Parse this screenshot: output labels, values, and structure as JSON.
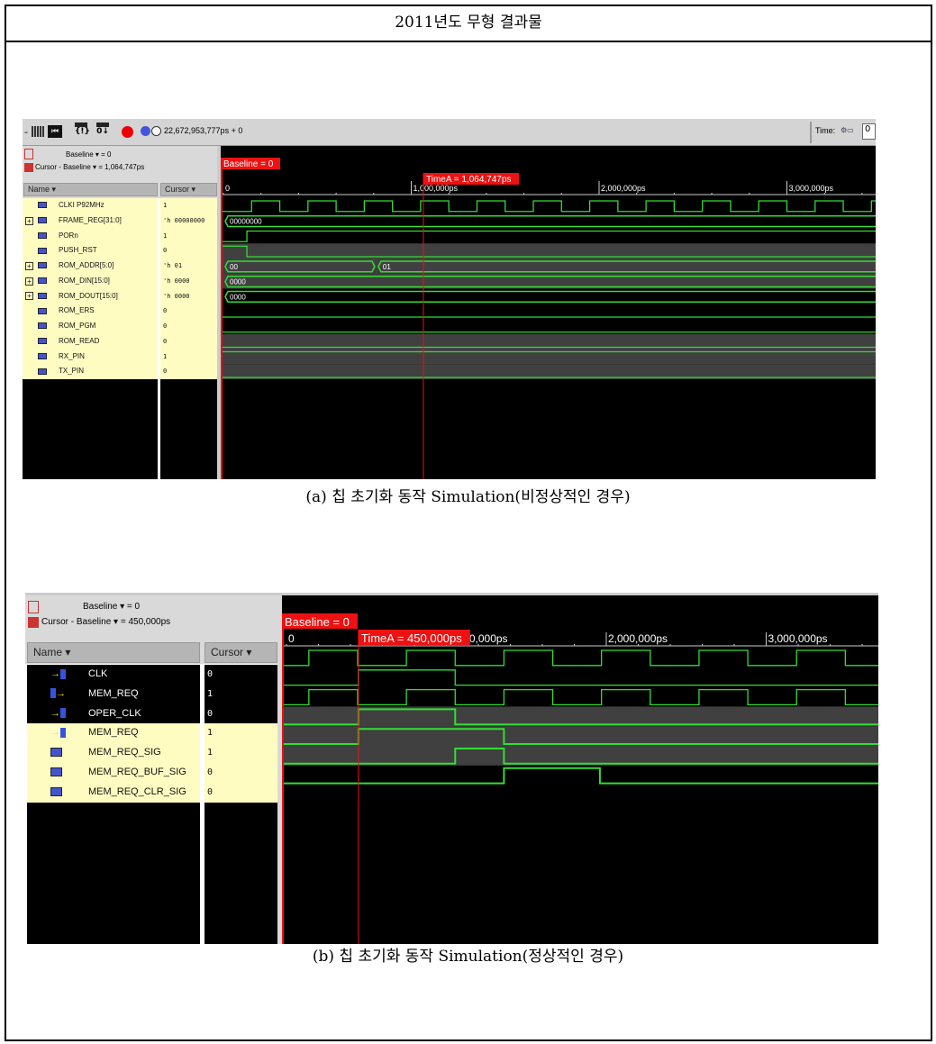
{
  "title": "2011년도 무형 결과물",
  "figure_a": {
    "caption": "(a) 칩 초기화 동작 Simulation(비정상적인 경우)",
    "toolbar": {
      "time_readout": "22,672,953,777ps + 0",
      "time_label": "Time:",
      "time_value": "0"
    },
    "baseline_text": "Baseline ▾ = 0",
    "cursor_baseline_text": "Cursor - Baseline ▾ = 1,064,747ps",
    "name_header": "Name ▾",
    "cursor_header": "Cursor ▾",
    "baseline_marker": "Baseline = 0",
    "timea_marker": "TimeA = 1,064,747ps",
    "cursor_ps": 1064747,
    "ticks": [
      {
        "t": 0,
        "label": "0"
      },
      {
        "t": 1000000,
        "label": "1,000,000ps"
      },
      {
        "t": 2000000,
        "label": "2,000,000ps"
      },
      {
        "t": 3000000,
        "label": "3,000,000ps"
      }
    ],
    "signals": [
      {
        "name": "CLKI P92MHz",
        "value": "1",
        "type": "clock",
        "period": 300000,
        "first_rise": 150000
      },
      {
        "name": "FRAME_REG[31:0]",
        "value": "'h 00000000",
        "type": "bus",
        "expandable": true,
        "segments": [
          {
            "t": 0,
            "v": "00000000"
          }
        ]
      },
      {
        "name": "PORn",
        "value": "1",
        "type": "bit",
        "init": 0,
        "edges": [
          125000
        ]
      },
      {
        "name": "PUSH_RST",
        "value": "0",
        "type": "bit",
        "init": 1,
        "edges": [
          125000
        ],
        "shade": true
      },
      {
        "name": "ROM_ADDR[5:0]",
        "value": "'h 01",
        "type": "bus",
        "expandable": true,
        "shade": true,
        "segments": [
          {
            "t": 0,
            "v": "00"
          },
          {
            "t": 815000,
            "v": "01"
          }
        ]
      },
      {
        "name": "ROM_DIN[15:0]",
        "value": "'h 0000",
        "type": "bus",
        "expandable": true,
        "shade": true,
        "segments": [
          {
            "t": 0,
            "v": "0000"
          }
        ]
      },
      {
        "name": "ROM_DOUT[15:0]",
        "value": "'h 0000",
        "type": "bus",
        "expandable": true,
        "segments": [
          {
            "t": 0,
            "v": "0000"
          }
        ]
      },
      {
        "name": "ROM_ERS",
        "value": "0",
        "type": "bit",
        "init": 0,
        "edges": []
      },
      {
        "name": "ROM_PGM",
        "value": "0",
        "type": "bit",
        "init": 0,
        "edges": []
      },
      {
        "name": "ROM_READ",
        "value": "0",
        "type": "bit",
        "init": 0,
        "edges": [],
        "shade": true
      },
      {
        "name": "RX_PIN",
        "value": "1",
        "type": "bit",
        "init": 1,
        "edges": [],
        "shade": true
      },
      {
        "name": "TX_PIN",
        "value": "0",
        "type": "bit",
        "init": 0,
        "edges": [],
        "shade": true
      }
    ]
  },
  "figure_b": {
    "caption": "(b) 칩 초기화 동작 Simulation(정상적인 경우)",
    "baseline_text": "Baseline ▾ = 0",
    "cursor_baseline_text": "Cursor - Baseline ▾ = 450,000ps",
    "name_header": "Name ▾",
    "cursor_header": "Cursor ▾",
    "baseline_marker": "Baseline = 0",
    "timea_marker": "TimeA = 450,000ps",
    "cursor_ps": 450000,
    "ticks": [
      {
        "t": 0,
        "label": "0"
      },
      {
        "t": 1000000,
        "label": "1,000,000ps"
      },
      {
        "t": 2000000,
        "label": "2,000,000ps"
      },
      {
        "t": 3000000,
        "label": "3,000,000ps"
      }
    ],
    "signals": [
      {
        "name": "CLK",
        "value": "0",
        "type": "clock",
        "period": 610000,
        "first_rise": 140000,
        "port": "in",
        "selected": true
      },
      {
        "name": "MEM_REQ",
        "value": "1",
        "type": "bit",
        "init": 0,
        "edges": [
          450000,
          1055000
        ],
        "port": "out",
        "selected": true
      },
      {
        "name": "OPER_CLK",
        "value": "0",
        "type": "clock",
        "period": 610000,
        "first_rise": 140000,
        "port": "in",
        "selected": true
      },
      {
        "name": "MEM_REQ",
        "value": "1",
        "type": "bit",
        "init": 0,
        "edges": [
          450000,
          1055000
        ],
        "port": "in",
        "shade": true,
        "thick": true
      },
      {
        "name": "MEM_REQ_SIG",
        "value": "1",
        "type": "bit",
        "init": 0,
        "edges": [
          450000,
          1360000
        ],
        "shade": true,
        "thick": true
      },
      {
        "name": "MEM_REQ_BUF_SIG",
        "value": "0",
        "type": "bit",
        "init": 0,
        "edges": [
          1055000,
          1360000
        ],
        "shade": true,
        "thick": true
      },
      {
        "name": "MEM_REQ_CLR_SIG",
        "value": "0",
        "type": "bit",
        "init": 0,
        "edges": [
          1360000,
          1960000
        ],
        "thick": true
      }
    ]
  },
  "colors": {
    "wave": "#33dd33",
    "marker": "#ee1111",
    "shade": "#404040",
    "panel": "#fffcc2"
  }
}
